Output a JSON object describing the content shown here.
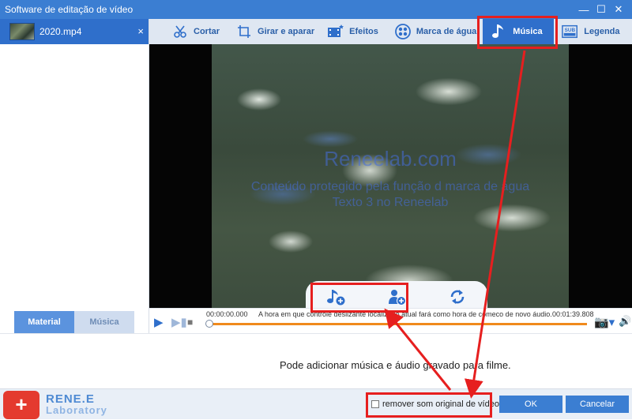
{
  "window": {
    "title": "Software de editação de vídeo",
    "btn_min": "—",
    "btn_max": "☐",
    "btn_close": "✕"
  },
  "file": {
    "name": "2020.mp4",
    "close": "×"
  },
  "left_tabs": {
    "material": "Material",
    "musica": "Música"
  },
  "toolbar": {
    "items": [
      {
        "label": "Cortar",
        "icon": "cut-icon"
      },
      {
        "label": "Girar e aparar",
        "icon": "rotate-crop-icon"
      },
      {
        "label": "Efeitos",
        "icon": "effects-icon"
      },
      {
        "label": "Marca de água",
        "icon": "watermark-icon"
      },
      {
        "label": "Música",
        "icon": "music-icon"
      },
      {
        "label": "Legenda",
        "icon": "subtitle-icon"
      }
    ]
  },
  "video": {
    "watermark_line1": "Reneelab.com",
    "watermark_line2": "Conteúdo protegido pela função d marca de água",
    "watermark_line3": "Texto 3 no Reneelab"
  },
  "timeline": {
    "start": "00:00:00.000",
    "end": "00:01:39.808",
    "hint": "A hora em que controle deslizante localizado atual fará como hora de comeco de novo áudio."
  },
  "info": {
    "text": "Pode adicionar música e áudio gravado para filme."
  },
  "footer": {
    "logo_line1": "RENE.E",
    "logo_line2": "Laboratory",
    "checkbox_label": "remover som original de vídeo",
    "ok": "OK",
    "cancel": "Cancelar"
  },
  "colors": {
    "accent": "#2f6fcb",
    "highlight": "#e61f1f",
    "progress": "#f08a1c"
  }
}
